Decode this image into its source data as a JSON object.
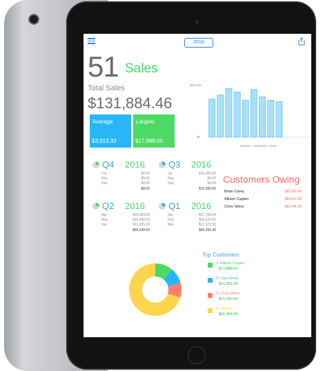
{
  "toolbar": {
    "year": "2016",
    "menu_icon": "menu-icon",
    "share_icon": "share-icon"
  },
  "header": {
    "count": "51",
    "count_label": "Sales",
    "total_label": "Total Sales",
    "total_value": "$131,884.46"
  },
  "tiles": [
    {
      "label": "Average",
      "value": "$3,913.33",
      "color": "#29b6f6"
    },
    {
      "label": "Largest",
      "value": "$17,888.00",
      "color": "#4cd964"
    }
  ],
  "chart_data": {
    "type": "bar",
    "categories": [
      "Jan",
      "Feb",
      "Mar",
      "Apr",
      "May",
      "Jun",
      "Jul",
      "Aug",
      "Sep",
      "Oct",
      "Nov",
      "Dec"
    ],
    "values": [
      16000,
      17800,
      20500,
      19000,
      15600,
      20200,
      17000,
      15500,
      15000,
      0,
      0,
      0
    ],
    "ytick_top": "$20,000",
    "ytick_bottom": "$0",
    "xlabel": "January - December, 2016",
    "ylim": [
      0,
      22000
    ]
  },
  "quarters": [
    {
      "name": "Q4",
      "year": "2016",
      "months": [
        "Oct",
        "Nov",
        "Dec"
      ],
      "values": [
        "$0.00",
        "$0.00",
        "$0.00"
      ],
      "total": "$0.00"
    },
    {
      "name": "Q3",
      "year": "2016",
      "months": [
        "Jul",
        "Aug",
        "Sep"
      ],
      "values": [
        "$15,060.00",
        "$0.00",
        "$0.00"
      ],
      "total": "$15,060.00"
    },
    {
      "name": "Q2",
      "year": "2016",
      "months": [
        "Apr",
        "May",
        "Jun"
      ],
      "values": [
        "$19,954.00",
        "$15,840.00",
        "$21,635.00"
      ],
      "total": "$56,539.00"
    },
    {
      "name": "Q1",
      "year": "2016",
      "months": [
        "Jan",
        "Feb",
        "Mar"
      ],
      "values": [
        "$17,758.00",
        "$20,110.00",
        "$22,372.50"
      ],
      "total": "$60,265.45"
    }
  ],
  "owing": {
    "title": "Customers Owing",
    "rows": [
      {
        "name": "Brian Carey",
        "amount": "$8,160.00"
      },
      {
        "name": "Allison Caplan",
        "amount": "$8,910.00"
      },
      {
        "name": "Chris Sifers",
        "amount": "$8,746.00"
      }
    ]
  },
  "top_customers": {
    "title": "Top Customers",
    "items": [
      {
        "name": "1. Allison Caplan",
        "value": "$17,888.00",
        "color": "#4cd964",
        "share": 0.11
      },
      {
        "name": "2. Lara Grant",
        "value": "$16,952.00",
        "color": "#29b6f6",
        "share": 0.1
      },
      {
        "name": "3. Chris Sifers",
        "value": "$15,060.00",
        "color": "#ff7f6e",
        "share": 0.09
      },
      {
        "name": "4. Others",
        "value": "$81,954.46",
        "color": "#ffd54f",
        "share": 0.7
      }
    ]
  }
}
